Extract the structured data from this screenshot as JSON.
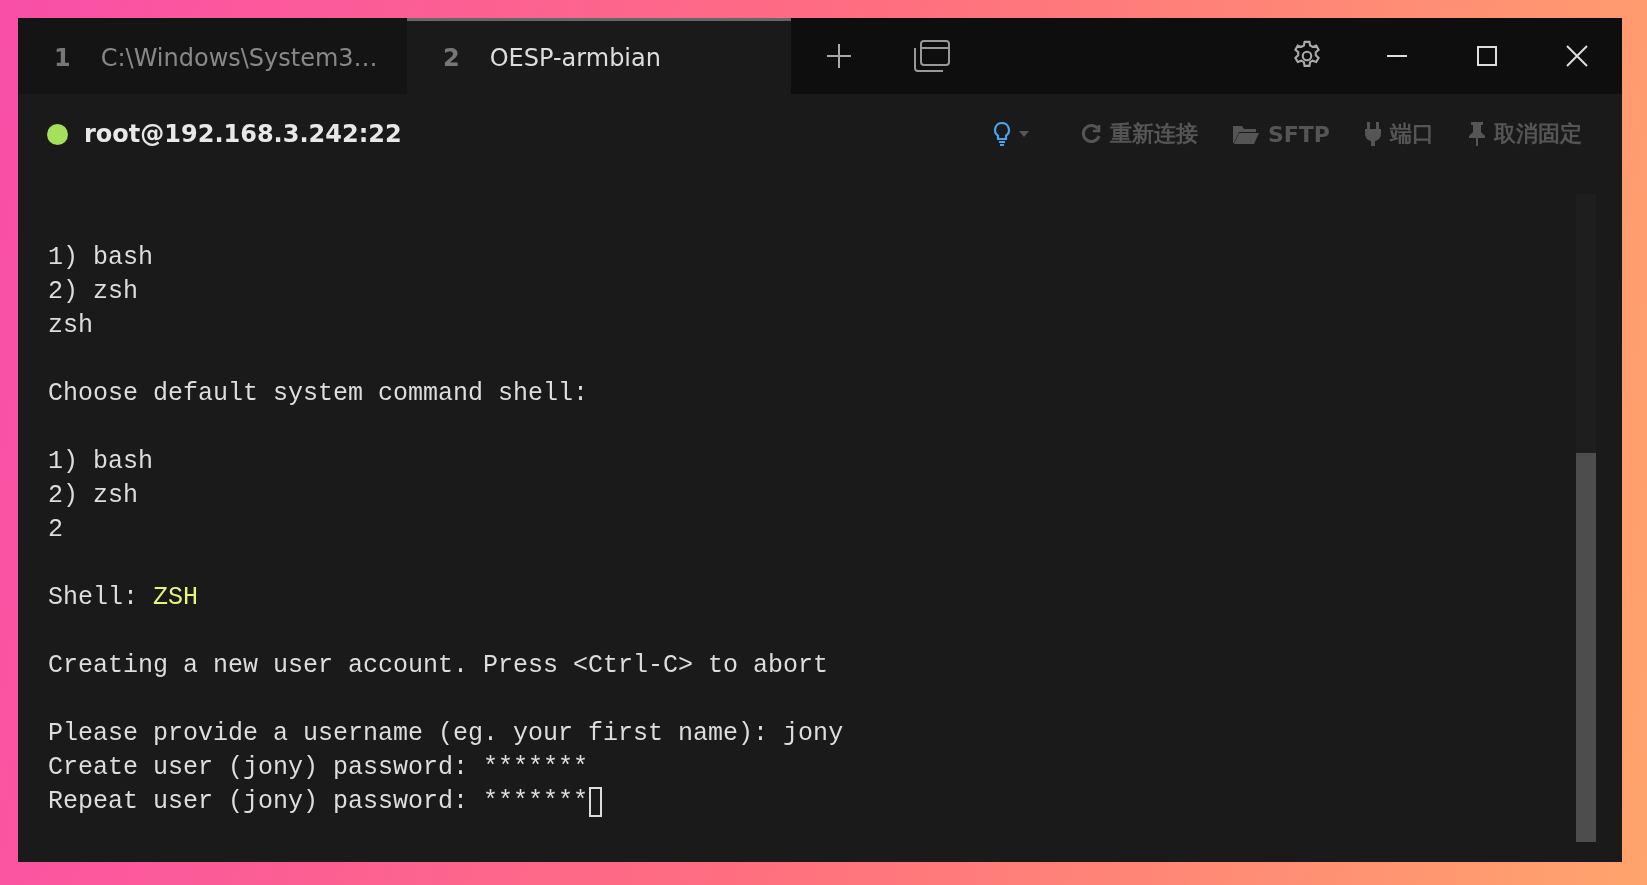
{
  "tabs": [
    {
      "number": "1",
      "label": "C:\\Windows\\System3…",
      "selected": false
    },
    {
      "number": "2",
      "label": "OESP-armbian",
      "selected": true
    }
  ],
  "connection": {
    "connected": true,
    "host": "root@192.168.3.242:22"
  },
  "toolbar": [
    {
      "kind": "tip"
    },
    {
      "kind": "reconnect",
      "label": "重新连接"
    },
    {
      "kind": "sftp",
      "label": "SFTP"
    },
    {
      "kind": "ports",
      "label": "端口"
    },
    {
      "kind": "unpin",
      "label": "取消固定"
    }
  ],
  "terminal": {
    "blocks": [
      [
        [
          {
            "text": "1) bash",
            "kind": "plain"
          }
        ],
        [
          {
            "text": "2) zsh",
            "kind": "plain"
          }
        ],
        [
          {
            "text": "zsh",
            "kind": "plain"
          }
        ]
      ],
      [
        [
          {
            "text": "Choose default system command shell:",
            "kind": "plain"
          }
        ]
      ],
      [
        [
          {
            "text": "1) bash",
            "kind": "plain"
          }
        ],
        [
          {
            "text": "2) zsh",
            "kind": "plain"
          }
        ],
        [
          {
            "text": "2",
            "kind": "plain"
          }
        ]
      ],
      [
        [
          {
            "text": "Shell: ",
            "kind": "plain"
          },
          {
            "text": "ZSH",
            "kind": "accent"
          }
        ]
      ],
      [
        [
          {
            "text": "Creating a new user account. Press <Ctrl-C> to abort",
            "kind": "plain"
          }
        ]
      ],
      [
        [
          {
            "text": "Please provide a username (eg. your first name): jony",
            "kind": "plain"
          }
        ],
        [
          {
            "text": "Create user (jony) password: *******",
            "kind": "plain"
          }
        ],
        [
          {
            "text": "Repeat user (jony) password: *******",
            "kind": "plain"
          }
        ]
      ]
    ],
    "cursor": true
  }
}
